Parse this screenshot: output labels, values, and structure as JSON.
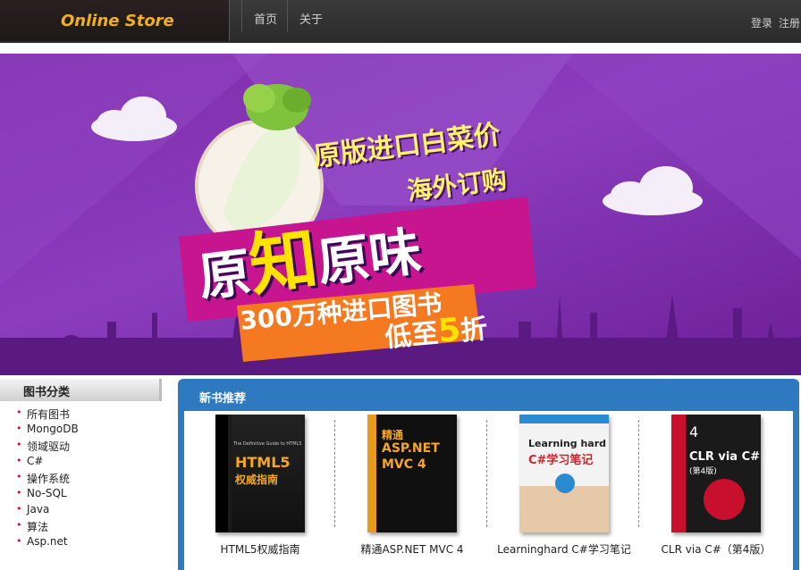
{
  "brand": "Online Store",
  "nav": {
    "home": "首页",
    "about": "关于"
  },
  "auth": {
    "login": "登录",
    "register": "注册"
  },
  "banner": {
    "line1": "原版进口白菜价",
    "line2": "海外订购",
    "line3_a": "原",
    "line3_b": "知",
    "line3_c": "原味",
    "line4": "300万种进口图书",
    "line5_a": "低至",
    "line5_b": "5",
    "line5_c": "折"
  },
  "sidebar": {
    "title": "图书分类",
    "items": [
      "所有图书",
      "MongoDB",
      "领域驱动",
      "C#",
      "操作系统",
      "No-SQL",
      "Java",
      "算法",
      "Asp.net"
    ]
  },
  "new_books": {
    "title": "新书推荐",
    "books": [
      {
        "title": "HTML5权威指南",
        "cover_main": "HTML5",
        "cover_sub": "权威指南",
        "cover_top": "The Definitive Guide to HTML5"
      },
      {
        "title": "精通ASP.NET MVC 4",
        "cover_main": "ASP.NET",
        "cover_sub": "MVC 4",
        "cover_top": "精通"
      },
      {
        "title": "Learninghard C#学习笔记",
        "cover_main": "Learning hard",
        "cover_sub": "C#学习笔记",
        "cover_top": ""
      },
      {
        "title": "CLR via C#（第4版）",
        "cover_main": "CLR via C#",
        "cover_sub": "(第4版)",
        "cover_top": "4"
      }
    ]
  },
  "colors": {
    "accent": "#f0b21a",
    "panel": "#2e79c0",
    "banner": "#7e2aa8",
    "bullet": "#c8102e"
  }
}
